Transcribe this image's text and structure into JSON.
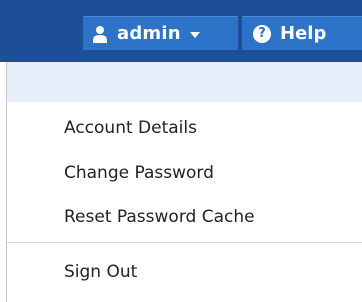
{
  "topbar": {
    "user_menu": {
      "label": "admin",
      "icon": "user-icon",
      "dropdown_icon": "caret-down-icon"
    },
    "help": {
      "label": "Help",
      "icon": "question-circle-icon",
      "icon_glyph": "?"
    }
  },
  "user_dropdown": {
    "items": [
      {
        "label": "Account Details"
      },
      {
        "label": "Change Password"
      },
      {
        "label": "Reset Password Cache"
      },
      {
        "label": "Sign Out"
      }
    ]
  },
  "colors": {
    "topbar_background": "#1c4f97",
    "button_background": "#2d74c8",
    "menu_header_background": "#e9eefc",
    "menu_text": "#222222"
  }
}
